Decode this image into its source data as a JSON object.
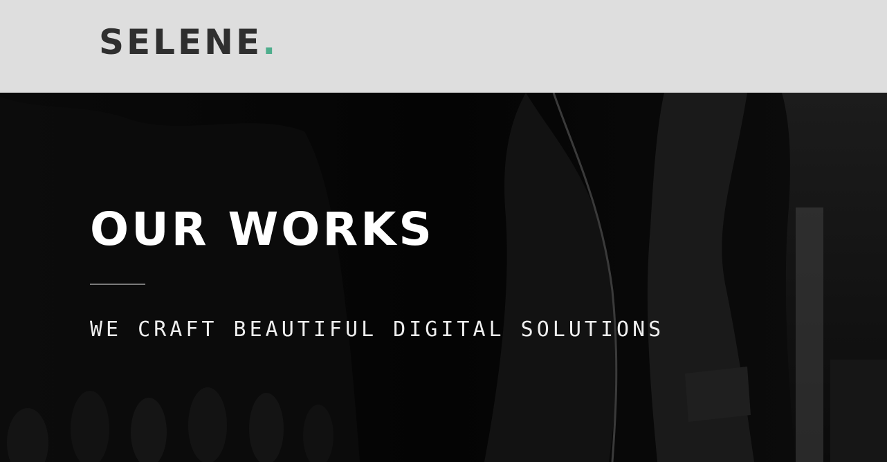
{
  "brand": {
    "name": "SELENE",
    "dot": ".",
    "accent_color": "#4fae8d",
    "text_color": "#2f2f2f"
  },
  "hero": {
    "title": "OUR WORKS",
    "subtitle": "WE CRAFT BEAUTIFUL DIGITAL SOLUTIONS"
  },
  "colors": {
    "header_bg": "#dedede",
    "hero_bg": "#020202",
    "hero_text": "#ffffff",
    "divider": "#7a7a7a"
  }
}
